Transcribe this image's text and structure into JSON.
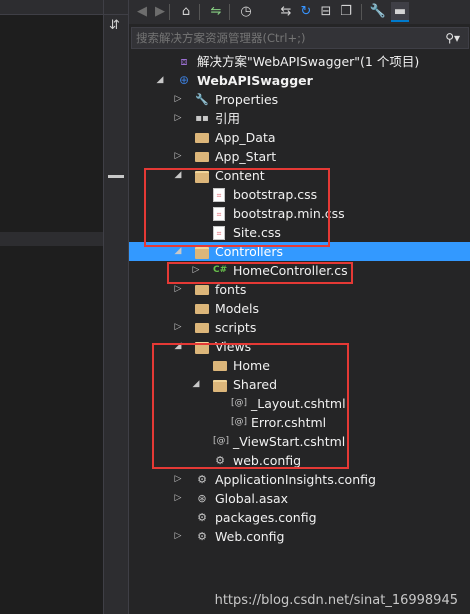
{
  "toolbar": {
    "buttons": [
      {
        "name": "back-icon",
        "glyph": "◀"
      },
      {
        "name": "forward-icon",
        "glyph": "▶"
      },
      {
        "name": "home-icon",
        "glyph": "⌂"
      },
      {
        "name": "sync-icon",
        "glyph": "⇋"
      },
      {
        "name": "history-icon",
        "glyph": "◷"
      },
      {
        "name": "switch-views-icon",
        "glyph": "⇆"
      },
      {
        "name": "refresh-icon",
        "glyph": "↻"
      },
      {
        "name": "collapse-all-icon",
        "glyph": "⊟"
      },
      {
        "name": "copy-icon",
        "glyph": "❐"
      },
      {
        "name": "properties-icon",
        "glyph": "🔧"
      },
      {
        "name": "preview-icon",
        "glyph": "▬"
      }
    ]
  },
  "search": {
    "placeholder": "搜索解决方案资源管理器(Ctrl+;)",
    "icon": "search-icon"
  },
  "tree": [
    {
      "label": "解决方案\"WebAPISwagger\"(1 个项目)",
      "icon": "solution-icon",
      "depth": 0,
      "arrow": ""
    },
    {
      "label": "WebAPISwagger",
      "icon": "project-icon",
      "depth": 0,
      "arrow": "expanded",
      "bold": true
    },
    {
      "label": "Properties",
      "icon": "wrench-icon",
      "depth": 1,
      "arrow": "collapsed"
    },
    {
      "label": "引用",
      "icon": "references-icon",
      "depth": 1,
      "arrow": "collapsed"
    },
    {
      "label": "App_Data",
      "icon": "folder-icon",
      "depth": 1,
      "arrow": ""
    },
    {
      "label": "App_Start",
      "icon": "folder-icon",
      "depth": 1,
      "arrow": "collapsed"
    },
    {
      "label": "Content",
      "icon": "folder-open-icon",
      "depth": 1,
      "arrow": "expanded"
    },
    {
      "label": "bootstrap.css",
      "icon": "css-file-icon",
      "depth": 2,
      "arrow": ""
    },
    {
      "label": "bootstrap.min.css",
      "icon": "css-file-icon",
      "depth": 2,
      "arrow": ""
    },
    {
      "label": "Site.css",
      "icon": "css-file-icon",
      "depth": 2,
      "arrow": ""
    },
    {
      "label": "Controllers",
      "icon": "folder-open-icon",
      "depth": 1,
      "arrow": "expanded",
      "selected": true
    },
    {
      "label": "HomeController.cs",
      "icon": "csharp-file-icon",
      "depth": 2,
      "arrow": "collapsed"
    },
    {
      "label": "fonts",
      "icon": "folder-icon",
      "depth": 1,
      "arrow": "collapsed"
    },
    {
      "label": "Models",
      "icon": "folder-icon",
      "depth": 1,
      "arrow": ""
    },
    {
      "label": "scripts",
      "icon": "folder-icon",
      "depth": 1,
      "arrow": "collapsed"
    },
    {
      "label": "Views",
      "icon": "folder-open-icon",
      "depth": 1,
      "arrow": "expanded"
    },
    {
      "label": "Home",
      "icon": "folder-icon",
      "depth": 2,
      "arrow": ""
    },
    {
      "label": "Shared",
      "icon": "folder-open-icon",
      "depth": 2,
      "arrow": "expanded"
    },
    {
      "label": "_Layout.cshtml",
      "icon": "cshtml-file-icon",
      "depth": 3,
      "arrow": ""
    },
    {
      "label": "Error.cshtml",
      "icon": "cshtml-file-icon",
      "depth": 3,
      "arrow": ""
    },
    {
      "label": "_ViewStart.cshtml",
      "icon": "cshtml-file-icon",
      "depth": 2,
      "arrow": ""
    },
    {
      "label": "web.config",
      "icon": "config-file-icon",
      "depth": 2,
      "arrow": ""
    },
    {
      "label": "ApplicationInsights.config",
      "icon": "config-file-icon",
      "depth": 1,
      "arrow": "collapsed"
    },
    {
      "label": "Global.asax",
      "icon": "global-asax-icon",
      "depth": 1,
      "arrow": "collapsed"
    },
    {
      "label": "packages.config",
      "icon": "config-file-icon",
      "depth": 1,
      "arrow": ""
    },
    {
      "label": "Web.config",
      "icon": "config-file-icon",
      "depth": 1,
      "arrow": "collapsed"
    }
  ],
  "highlight_color": "#e53935",
  "selection_color": "#3399ff",
  "watermark": "https://blog.csdn.net/sinat_16998945"
}
